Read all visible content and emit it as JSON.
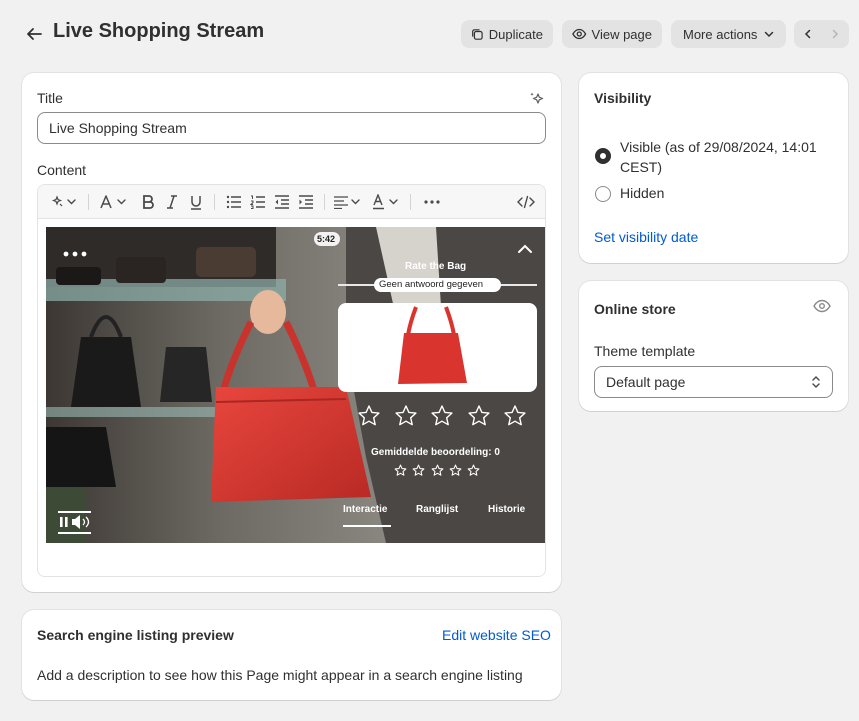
{
  "header": {
    "title": "Live Shopping Stream",
    "duplicate_label": "Duplicate",
    "view_page_label": "View page",
    "more_actions_label": "More actions"
  },
  "main": {
    "title_label": "Title",
    "title_value": "Live Shopping Stream",
    "content_label": "Content",
    "toolbar_icons": [
      "magic-icon",
      "text-format-icon",
      "bold-icon",
      "italic-icon",
      "underline-icon",
      "bullet-list-icon",
      "numbered-list-icon",
      "outdent-icon",
      "indent-icon",
      "align-icon",
      "text-color-icon",
      "more-icon",
      "code-icon"
    ],
    "video": {
      "duration": "5:42",
      "widget_title": "Rate the Bag",
      "answer_status": "Geen antwoord gegeven",
      "average_label": "Gemiddelde beoordeling: 0",
      "rating_stars": 5,
      "average_stars": 5,
      "tabs": [
        "Interactie",
        "Ranglijst",
        "Historie"
      ],
      "active_tab": "Interactie"
    }
  },
  "seo": {
    "title": "Search engine listing preview",
    "edit_link": "Edit website SEO",
    "description": "Add a description to see how this Page might appear in a search engine listing"
  },
  "visibility": {
    "title": "Visibility",
    "visible_label": "Visible (as of 29/08/2024, 14:01 CEST)",
    "hidden_label": "Hidden",
    "selected": "visible",
    "set_date_link": "Set visibility date"
  },
  "online_store": {
    "title": "Online store",
    "template_label": "Theme template",
    "template_value": "Default page"
  },
  "colors": {
    "background": "#f1f1f1",
    "card": "#ffffff",
    "link": "#005bd3",
    "bag_red": "#d9352e"
  }
}
